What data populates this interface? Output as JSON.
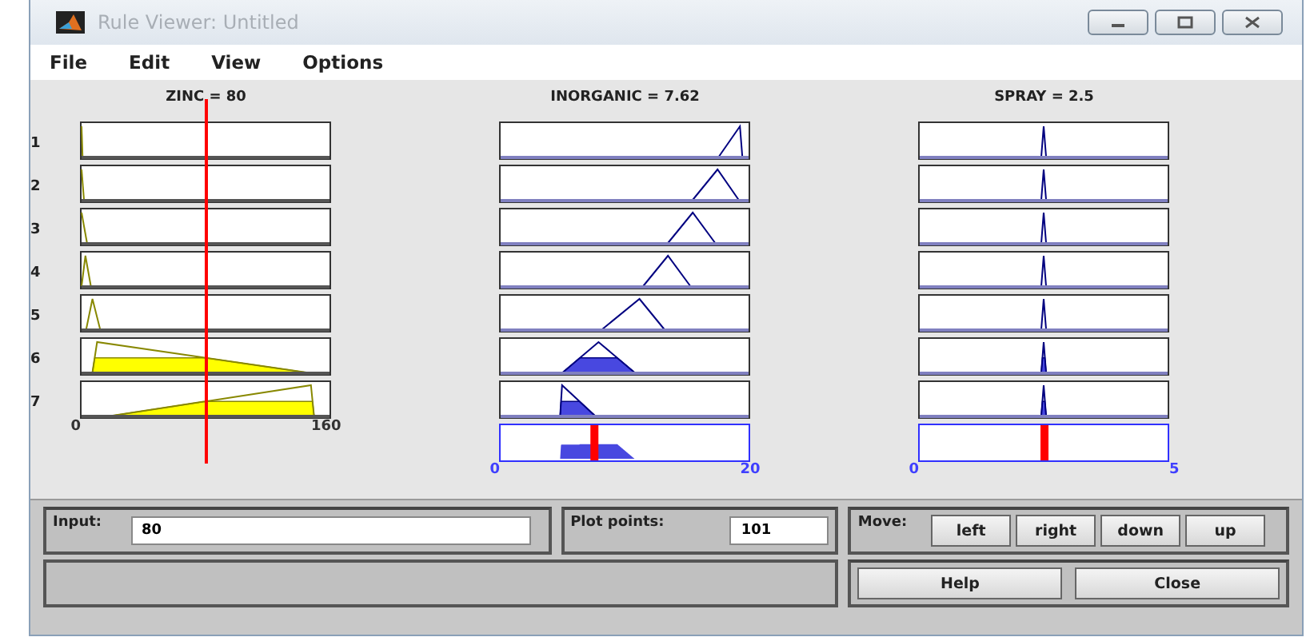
{
  "window": {
    "title": "Rule Viewer: Untitled"
  },
  "menu": [
    {
      "label": "File"
    },
    {
      "label": "Edit"
    },
    {
      "label": "View"
    },
    {
      "label": "Options"
    }
  ],
  "variables": [
    {
      "title": "ZINC = 80",
      "kind": "input",
      "ticks": [
        "0",
        "160"
      ]
    },
    {
      "title": "INORGANIC = 7.62",
      "kind": "output",
      "ticks": [
        "0",
        "20"
      ]
    },
    {
      "title": "SPRAY = 2.5",
      "kind": "output",
      "ticks": [
        "0",
        "5"
      ]
    }
  ],
  "rules": [
    "1",
    "2",
    "3",
    "4",
    "5",
    "6",
    "7"
  ],
  "input_field": {
    "label": "Input:",
    "value": "80"
  },
  "plot_points": {
    "label": "Plot points:",
    "value": "101"
  },
  "move": {
    "label": "Move:",
    "buttons": [
      "left",
      "right",
      "down",
      "up"
    ]
  },
  "buttons": [
    "Help",
    "Close"
  ]
}
